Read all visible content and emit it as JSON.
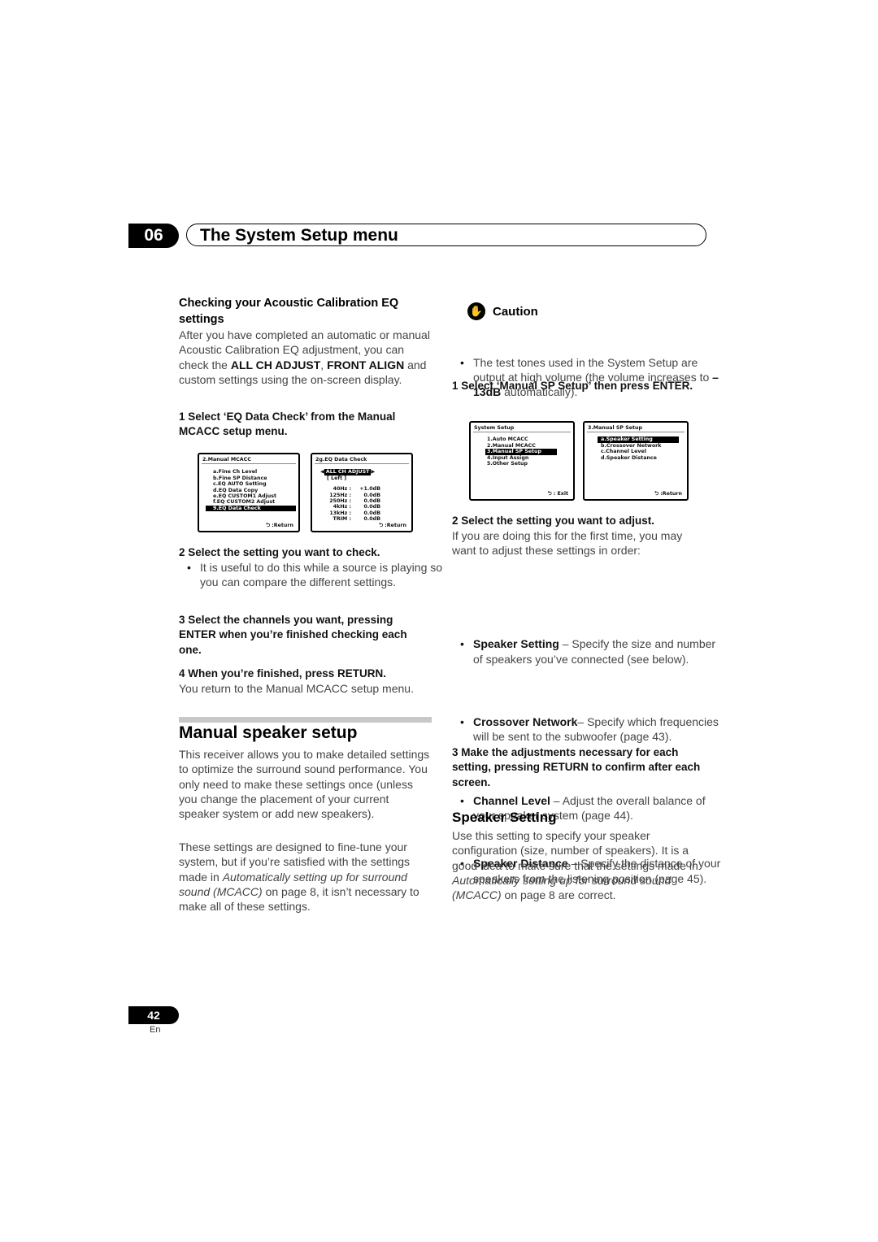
{
  "header": {
    "chapter": "06",
    "title": "The System Setup menu"
  },
  "left": {
    "heading": "Checking your Acoustic Calibration EQ settings",
    "intro": [
      "After you have completed an automatic or manual Acoustic Calibration EQ adjustment, you can check the ",
      "ALL CH ADJUST",
      ", ",
      "FRONT ALIGN",
      " and custom settings using the on-screen display."
    ],
    "step1": "1   Select ‘EQ Data Check’ from the Manual MCACC setup menu.",
    "screen1": {
      "title": "2.Manual  MCACC",
      "items": [
        "a.Fine  Ch  Level",
        "b.Fine  SP  Distance",
        "c.EQ  AUTO  Setting",
        "d.EQ  Data  Copy",
        "e.EQ  CUSTOM1  Adjust",
        "f.EQ  CUSTOM2  Adjust",
        "9.EQ  Data  Check"
      ],
      "footer": "⮌ :Return"
    },
    "screen2": {
      "title": "2g.EQ  Data  Check",
      "selector": "ALL  CH  ADJUST",
      "channel": "[ Left              ]",
      "rows": [
        [
          "40Hz :",
          "+1.0dB"
        ],
        [
          "125Hz :",
          "0.0dB"
        ],
        [
          "250Hz :",
          "0.0dB"
        ],
        [
          "4kHz :",
          "0.0dB"
        ],
        [
          "13kHz :",
          "0.0dB"
        ],
        [
          "TRIM :",
          "0.0dB"
        ]
      ],
      "footer": "⮌ :Return"
    },
    "step2": "2   Select the setting you want to check.",
    "step2_bullet": "It is useful to do this while a source is playing so you can compare the different settings.",
    "step3": "3   Select the channels you want, pressing ENTER when you’re finished checking each one.",
    "step4": "4   When you’re finished, press RETURN.",
    "step4_text": "You return to the Manual MCACC setup menu.",
    "section_title": "Manual speaker setup",
    "para1": "This receiver allows you to make detailed settings to optimize the surround sound performance. You only need to make these settings once (unless you change the placement of your current speaker system or add new speakers).",
    "para2": [
      "These settings are designed to fine-tune your system, but if you’re satisfied with the settings made in ",
      "Automatically setting up for surround sound (MCACC)",
      " on page 8, it isn’t necessary to make all of these settings."
    ]
  },
  "right": {
    "caution_title": "Caution",
    "caution_icon": "hand-stop-icon",
    "caution_text": [
      "The test tones used in the System Setup are output at high volume (the volume increases to ",
      "–13dB",
      " automatically)."
    ],
    "step1": "1   Select ‘Manual SP Setup’ then press ENTER.",
    "screen1": {
      "title": "System  Setup",
      "items": [
        "1.Auto  MCACC",
        "2.Manual  MCACC",
        "3.Manual  SP  Setup",
        "4.Input  Assign",
        "5.Other  Setup"
      ],
      "footer": "⮌ : Exit"
    },
    "screen2": {
      "title": "3.Manual  SP  Setup",
      "items": [
        "a.Speaker  Setting",
        "b.Crossover  Network",
        "c.Channel  Level",
        "d.Speaker  Distance"
      ],
      "footer": "⮌ :Return"
    },
    "step2": "2   Select the setting you want to adjust.",
    "step2_text": "If you are doing this for the first time, you may want to adjust these settings in order:",
    "bullets": [
      {
        "term": "Speaker Setting",
        "text": " – Specify the size and number of speakers you’ve connected (see below)."
      },
      {
        "term": "Crossover Network",
        "text": "– Specify which frequencies will be sent to the subwoofer (page 43)."
      },
      {
        "term": "Channel Level",
        "text": " – Adjust the overall balance of your speaker system (page 44)."
      },
      {
        "term": "Speaker Distance",
        "text": " – Specify the distance of your speakers from the listening position (page 45)."
      }
    ],
    "step3": "3   Make the adjustments necessary for each setting, pressing RETURN to confirm after each screen.",
    "subsection_title": "Speaker Setting",
    "para": [
      "Use this setting to specify your speaker configuration (size, number of speakers). It is a good idea to make sure that the settings made in ",
      "Automatically setting up for surround sound (MCACC)",
      " on page 8 are correct."
    ]
  },
  "footer": {
    "page": "42",
    "lang": "En"
  }
}
